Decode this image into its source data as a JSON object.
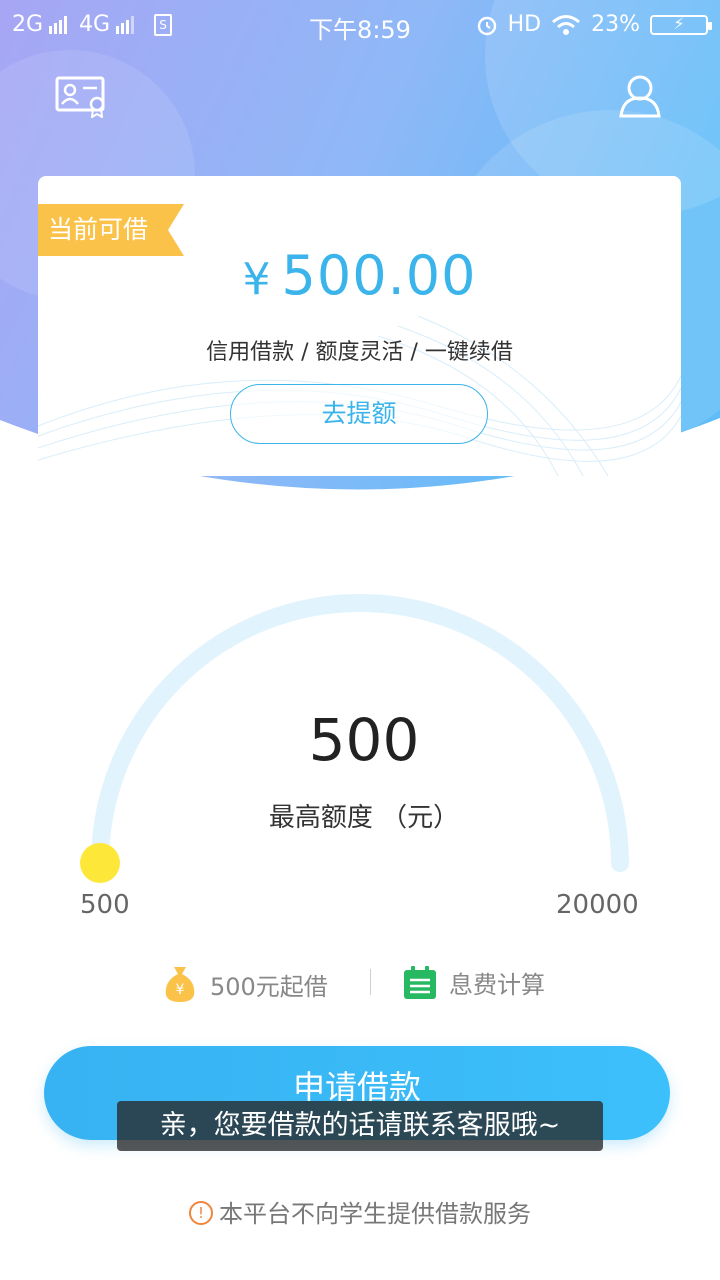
{
  "status_bar": {
    "network1": "2G",
    "network2": "4G",
    "time": "下午8:59",
    "hd": "HD",
    "battery_percent": "23%"
  },
  "header": {
    "left_icon": "id-card-icon",
    "right_icon": "user-icon"
  },
  "card": {
    "ribbon": "当前可借",
    "currency": "¥",
    "amount": "500.00",
    "subtitle": "信用借款 / 额度灵活 / 一键续借",
    "raise_button": "去提额"
  },
  "gauge": {
    "value": "500",
    "label": "最高额度  （元）",
    "min": "500",
    "max": "20000",
    "position": 0
  },
  "info": {
    "min_borrow": "500元起借",
    "interest_calc": "息费计算",
    "yen_mark": "¥"
  },
  "apply_button": "申请借款",
  "toast": "亲，您要借款的话请联系客服哦~",
  "notice": "本平台不向学生提供借款服务",
  "colors": {
    "primary": "#3ab4ea",
    "ribbon": "#fbc24a",
    "knob": "#fde83a",
    "track": "#e1f3fc"
  }
}
